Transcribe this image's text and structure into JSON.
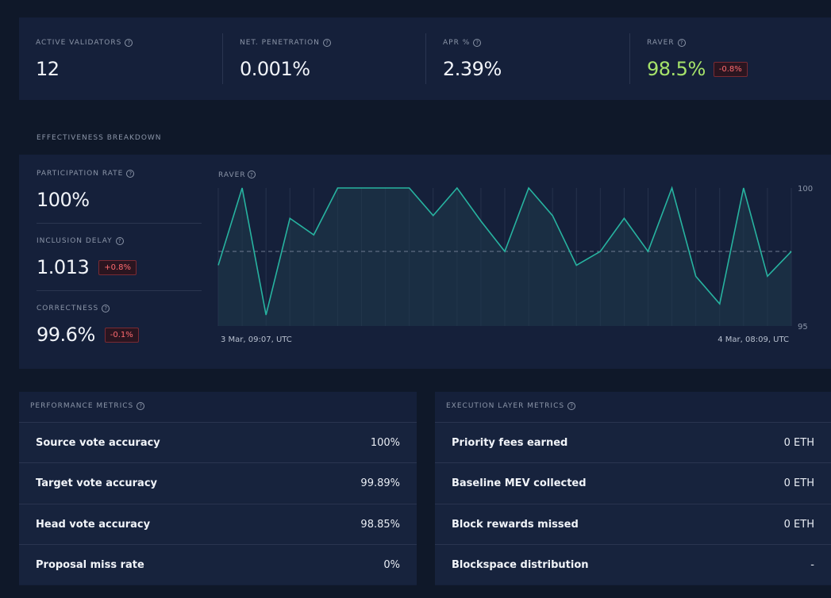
{
  "stats": [
    {
      "label": "ACTIVE VALIDATORS",
      "value": "12"
    },
    {
      "label": "NET. PENETRATION",
      "value": "0.001%"
    },
    {
      "label": "APR %",
      "value": "2.39%"
    },
    {
      "label": "RAVER",
      "value": "98.5%",
      "badge": "-0.8%"
    }
  ],
  "effectiveness": {
    "title": "EFFECTIVENESS BREAKDOWN",
    "items": [
      {
        "label": "PARTICIPATION RATE",
        "value": "100%"
      },
      {
        "label": "INCLUSION DELAY",
        "value": "1.013",
        "badge": "+0.8%"
      },
      {
        "label": "CORRECTNESS",
        "value": "99.6%",
        "badge": "-0.1%"
      }
    ]
  },
  "chart_data": {
    "type": "line",
    "title": "RAVER",
    "x_start_label": "3 Mar, 09:07, UTC",
    "x_end_label": "4 Mar, 08:09, UTC",
    "y_ticks": [
      "100",
      "95"
    ],
    "ylim": [
      95,
      100
    ],
    "reference_line": 97.7,
    "values": [
      97.2,
      100,
      95.4,
      98.9,
      98.3,
      100,
      100,
      100,
      100,
      99.0,
      100,
      98.8,
      97.7,
      100,
      99.0,
      97.2,
      97.7,
      98.9,
      97.7,
      100,
      96.8,
      95.8,
      100,
      96.8,
      97.7
    ],
    "colors": {
      "line": "#27b3a0",
      "reference": "#6f7a90"
    }
  },
  "performance": {
    "title": "PERFORMANCE METRICS",
    "rows": [
      {
        "label": "Source vote accuracy",
        "value": "100%"
      },
      {
        "label": "Target vote accuracy",
        "value": "99.89%"
      },
      {
        "label": "Head vote accuracy",
        "value": "98.85%"
      },
      {
        "label": "Proposal miss rate",
        "value": "0%"
      }
    ]
  },
  "execution": {
    "title": "EXECUTION LAYER METRICS",
    "rows": [
      {
        "label": "Priority fees earned",
        "value": "0 ETH"
      },
      {
        "label": "Baseline MEV collected",
        "value": "0 ETH"
      },
      {
        "label": "Block rewards missed",
        "value": "0 ETH"
      },
      {
        "label": "Blockspace distribution",
        "value": "-"
      }
    ]
  },
  "colors": {
    "accent_green": "#a6e36a",
    "badge_red": "#ff6b70"
  }
}
